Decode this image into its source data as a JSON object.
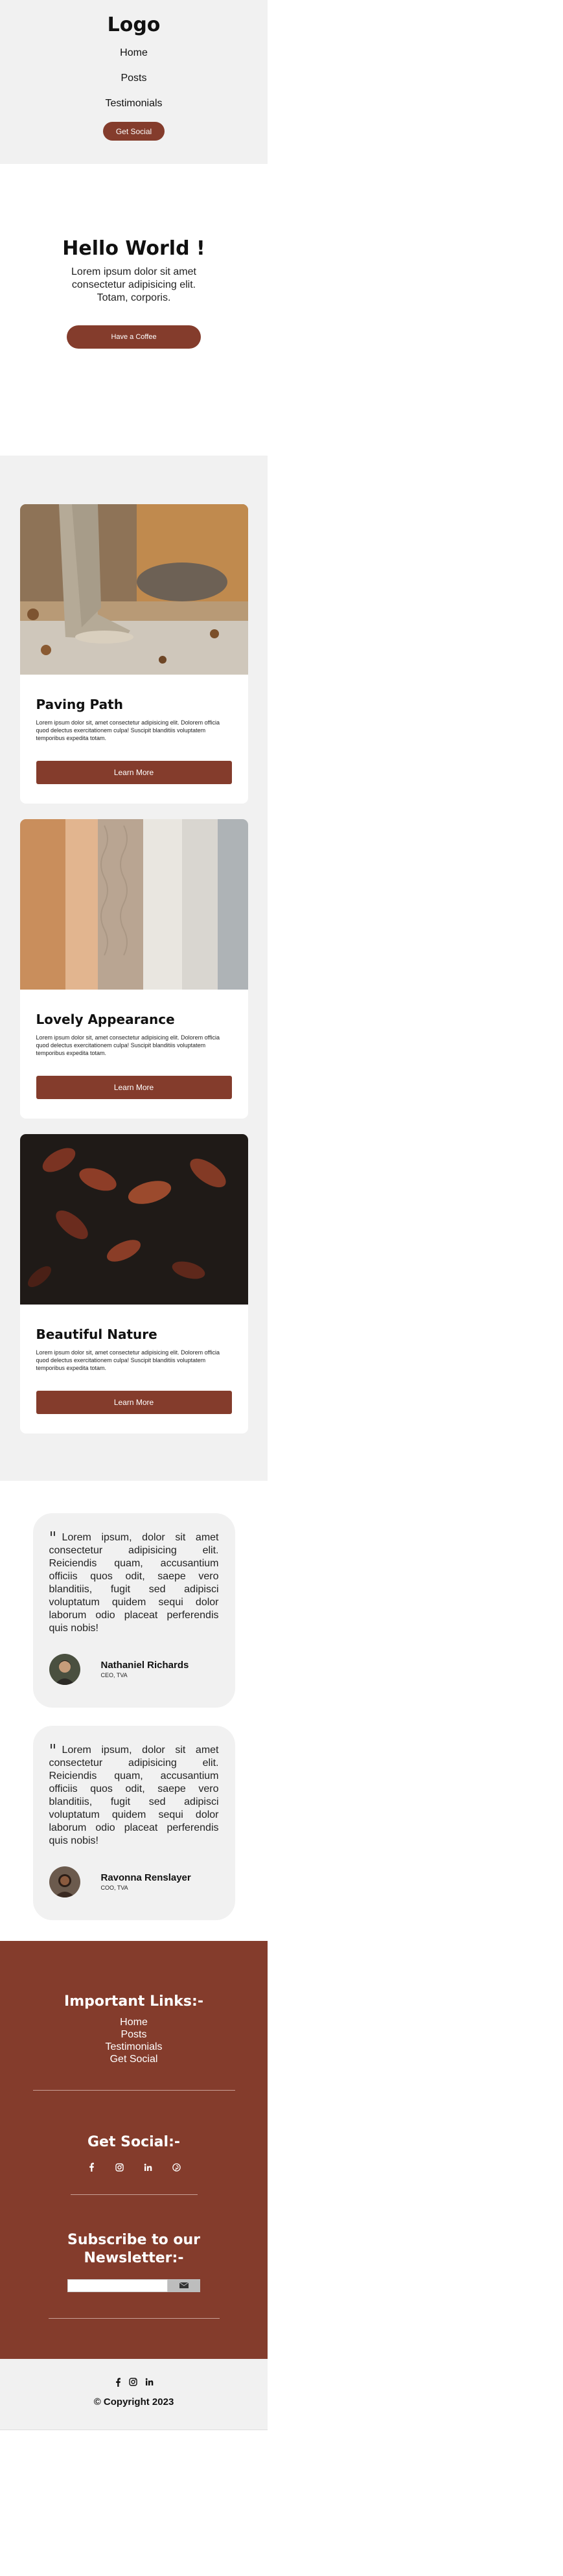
{
  "header": {
    "logo": "Logo",
    "nav": [
      "Home",
      "Posts",
      "Testimonials"
    ],
    "cta": "Get Social"
  },
  "hero": {
    "title": "Hello World !",
    "text": "Lorem ipsum dolor sit amet consectetur adipisicing elit. Totam, corporis.",
    "button": "Have a Coffee"
  },
  "cards": [
    {
      "title": "Paving Path",
      "text": "Lorem ipsum dolor sit, amet consectetur adipisicing elit. Dolorem officia quod delectus exercitationem culpa! Suscipit blanditiis voluptatem temporibus expedita totam.",
      "button": "Learn More",
      "image": "boots-walking-leaves"
    },
    {
      "title": "Lovely Appearance",
      "text": "Lorem ipsum dolor sit, amet consectetur adipisicing elit. Dolorem officia quod delectus exercitationem culpa! Suscipit blanditiis voluptatem temporibus expedita totam.",
      "button": "Learn More",
      "image": "folded-knit-sweaters"
    },
    {
      "title": "Beautiful Nature",
      "text": "Lorem ipsum dolor sit, amet consectetur adipisicing elit. Dolorem officia quod delectus exercitationem culpa! Suscipit blanditiis voluptatem temporibus expedita totam.",
      "button": "Learn More",
      "image": "autumn-red-leaves"
    }
  ],
  "testimonials": [
    {
      "quote_mark": "\"",
      "text": "Lorem ipsum, dolor sit amet consectetur adipisicing elit. Reiciendis quam, accusantium officiis quos odit, saepe vero blanditiis, fugit sed adipisci voluptatum quidem sequi dolor laborum odio placeat perferendis quis nobis!",
      "name": "Nathaniel Richards",
      "role": "CEO, TVA"
    },
    {
      "quote_mark": "\"",
      "text": "Lorem ipsum, dolor sit amet consectetur adipisicing elit. Reiciendis quam, accusantium officiis quos odit, saepe vero blanditiis, fugit sed adipisci voluptatum quidem sequi dolor laborum odio placeat perferendis quis nobis!",
      "name": "Ravonna Renslayer",
      "role": "COO, TVA"
    }
  ],
  "footer": {
    "links_title": "Important Links:-",
    "links": [
      "Home",
      "Posts",
      "Testimonials",
      "Get Social"
    ],
    "social_title": "Get Social:-",
    "social_icons": [
      "facebook-icon",
      "instagram-icon",
      "linkedin-icon",
      "pinterest-icon"
    ],
    "newsletter_title": "Subscribe to our Newsletter:-",
    "newsletter_placeholder": "",
    "submit_icon": "send-icon"
  },
  "bottom": {
    "social_icons": [
      "facebook-icon",
      "instagram-icon",
      "linkedin-icon"
    ],
    "copyright": "© Copyright 2023"
  },
  "colors": {
    "accent": "#843c2c",
    "light_bg": "#f1f1f1"
  }
}
